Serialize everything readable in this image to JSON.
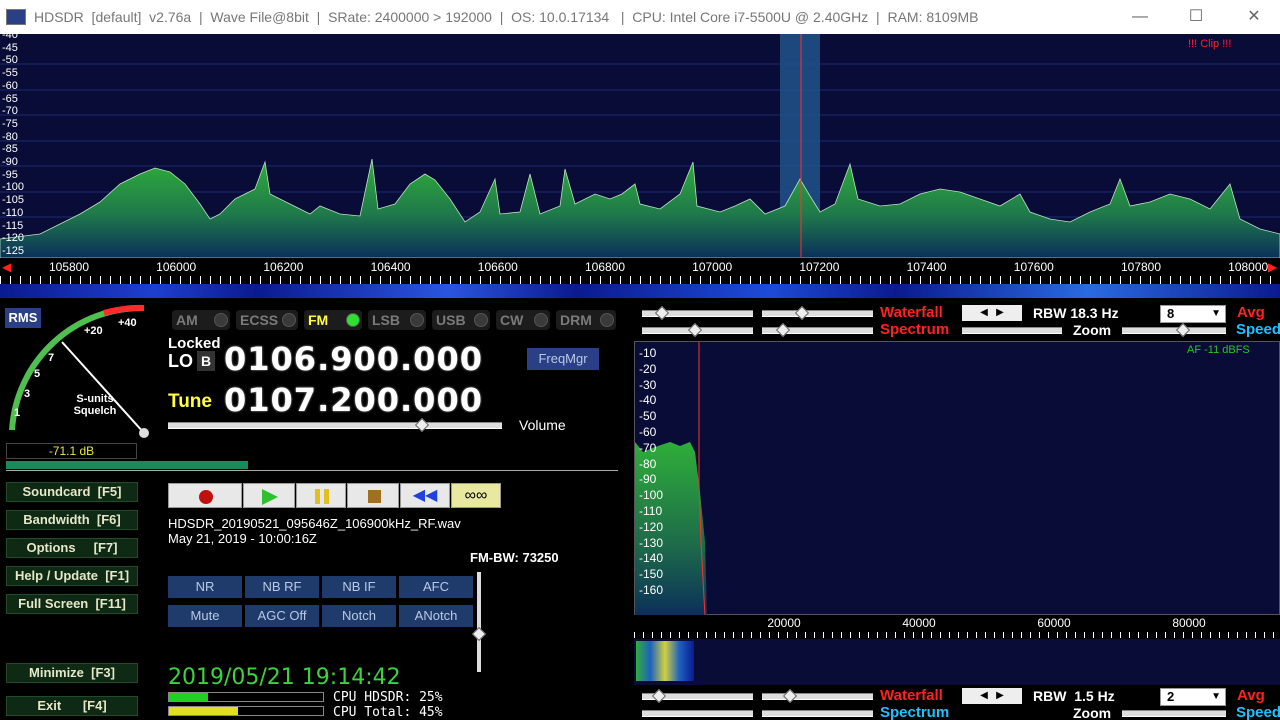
{
  "window": {
    "title": "HDSDR  [default]  v2.76a  |  Wave File@8bit  |  SRate: 2400000 > 192000  |  OS: 10.0.17134   |  CPU: Intel Core i7-5500U @ 2.40GHz  |  RAM: 8109MB",
    "min_icon": "minimize-icon",
    "max_icon": "maximize-icon",
    "close_icon": "close-icon",
    "min": "—",
    "max": "☐",
    "close": "✕"
  },
  "spectrum": {
    "clip": "!!! Clip !!!",
    "y_ticks": [
      "-40",
      "-45",
      "-50",
      "-55",
      "-60",
      "-65",
      "-70",
      "-75",
      "-80",
      "-85",
      "-90",
      "-95",
      "-100",
      "-105",
      "-110",
      "-115",
      "-120",
      "-125"
    ],
    "x_ticks": [
      "105800",
      "106000",
      "106200",
      "106400",
      "106600",
      "106800",
      "107000",
      "107200",
      "107400",
      "107600",
      "107800",
      "108000"
    ]
  },
  "smeter": {
    "rms": "RMS",
    "labels": [
      "1",
      "3",
      "5",
      "7",
      "+20",
      "+40"
    ],
    "caption1": "S-units",
    "caption2": "Squelch",
    "db": "-71.1 dB"
  },
  "modes": [
    "AM",
    "ECSS",
    "FM",
    "LSB",
    "USB",
    "CW",
    "DRM"
  ],
  "active_mode": "FM",
  "lo": {
    "locked": "Locked",
    "label": "LO",
    "b": "B",
    "freq": "0106.900.000"
  },
  "tune": {
    "label": "Tune",
    "freq": "0107.200.000"
  },
  "freqmgr": "FreqMgr",
  "volume": {
    "label": "Volume",
    "level": 0.76
  },
  "left_buttons": [
    {
      "label": "Soundcard  [F5]"
    },
    {
      "label": "Bandwidth  [F6]"
    },
    {
      "label": "Options     [F7]"
    },
    {
      "label": "Help / Update  [F1]"
    },
    {
      "label": "Full Screen  [F11]"
    },
    {
      "label": "Minimize  [F3]"
    },
    {
      "label": "Exit      [F4]"
    }
  ],
  "playback": {
    "record_icon": "record-icon",
    "play_icon": "play-icon",
    "pause_icon": "pause-icon",
    "stop_icon": "stop-icon",
    "rewind_icon": "rewind-icon",
    "loop_icon": "loop-icon"
  },
  "file": {
    "name": "HDSDR_20190521_095646Z_106900kHz_RF.wav",
    "date": "May 21, 2019 - 10:00:16Z"
  },
  "fm_bw": "FM-BW: 73250",
  "dsp": [
    "NR",
    "NB RF",
    "NB IF",
    "AFC",
    "Mute",
    "AGC Off",
    "Notch",
    "ANotch"
  ],
  "clock": "2019/05/21 19:14:42",
  "cpu": {
    "hdsdr": "CPU HDSDR:  25%",
    "total": "CPU Total:  45%",
    "hdsdr_pct": 25,
    "total_pct": 45
  },
  "rf_controls": {
    "waterfall": "Waterfall",
    "spectrum": "Spectrum",
    "rbw": "RBW 18.3 Hz",
    "zoom": "Zoom",
    "avg_value": "8",
    "avg": "Avg",
    "speed": "Speed"
  },
  "audio": {
    "af": "AF -11 dBFS",
    "y_ticks": [
      "-10",
      "-20",
      "-30",
      "-40",
      "-50",
      "-60",
      "-70",
      "-80",
      "-90",
      "-100",
      "-110",
      "-120",
      "-130",
      "-140",
      "-150",
      "-160"
    ],
    "x_ticks": [
      "20000",
      "40000",
      "60000",
      "80000"
    ]
  },
  "af_controls": {
    "waterfall": "Waterfall",
    "spectrum": "Spectrum",
    "rbw": "RBW  1.5 Hz",
    "zoom": "Zoom",
    "avg_value": "2",
    "avg": "Avg",
    "speed": "Speed"
  }
}
